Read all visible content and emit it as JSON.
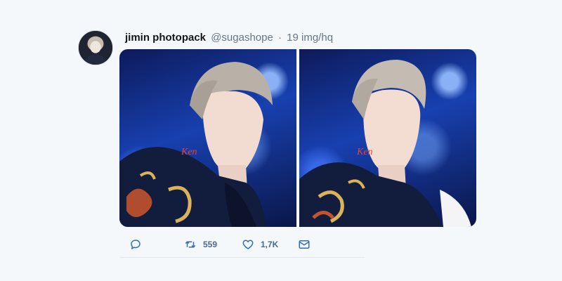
{
  "tweet": {
    "display_name": "jimin photopack",
    "handle": "@sugashope",
    "separator": "·",
    "text": "19 img/hq",
    "avatar_icon": "profile-photo",
    "media": [
      {
        "icon": "concert-photo",
        "embroidery": "Ken"
      },
      {
        "icon": "concert-photo",
        "embroidery": "Ken"
      }
    ]
  },
  "actions": {
    "reply_icon": "reply-icon",
    "retweet_icon": "retweet-icon",
    "retweet_count": "559",
    "like_icon": "heart-icon",
    "like_count": "1,7K",
    "dm_icon": "envelope-icon"
  },
  "colors": {
    "background": "#f5f8fa",
    "text_primary": "#14171a",
    "text_secondary": "#657786",
    "photo_blue": "#1840b0"
  }
}
